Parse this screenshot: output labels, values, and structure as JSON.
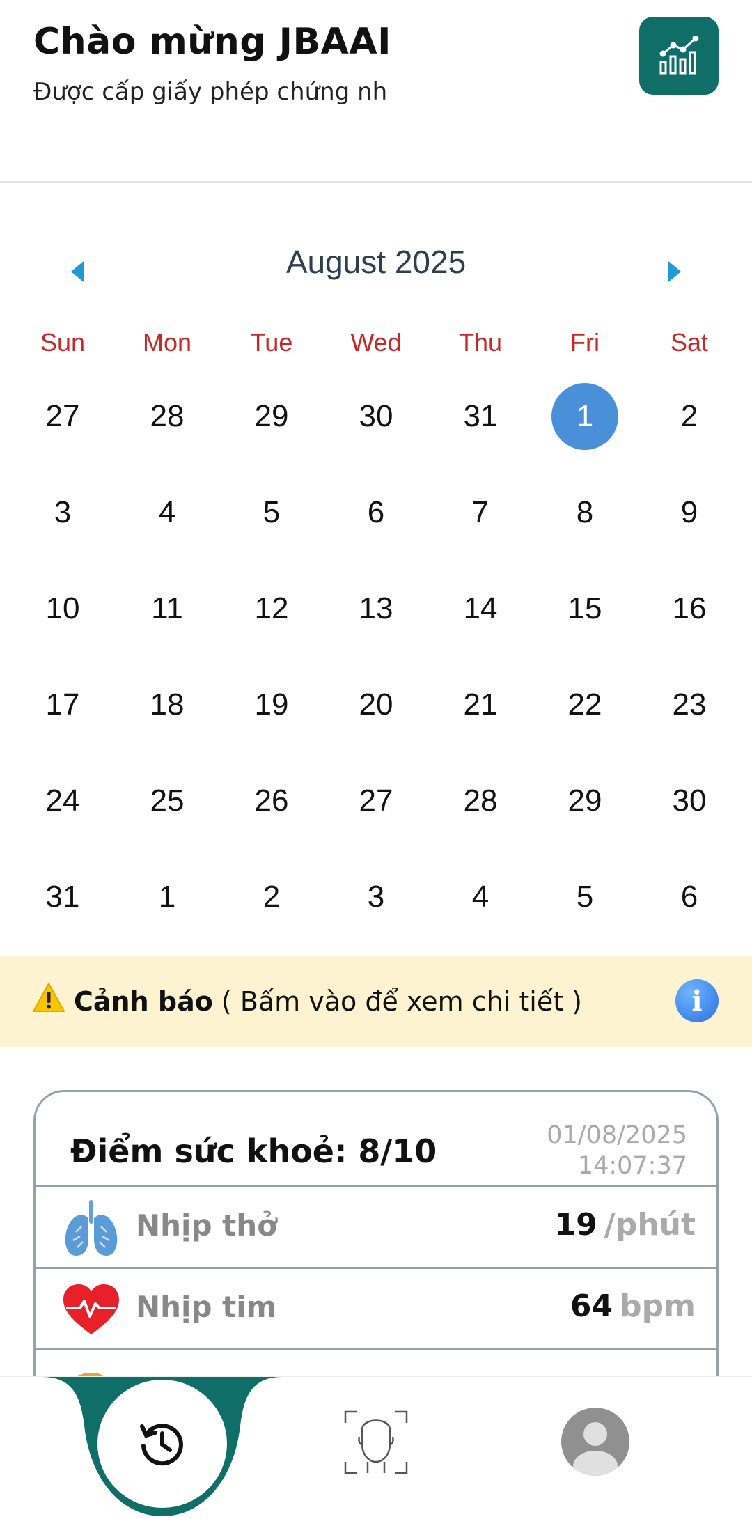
{
  "header": {
    "welcome": "Chào mừng JBAAI",
    "license": "Được cấp giấy phép chứng nh",
    "stats_icon": "chart-icon"
  },
  "calendar": {
    "month_title": "August 2025",
    "prev_icon": "caret-left-icon",
    "next_icon": "caret-right-icon",
    "weekdays": [
      "Sun",
      "Mon",
      "Tue",
      "Wed",
      "Thu",
      "Fri",
      "Sat"
    ],
    "days": [
      "27",
      "28",
      "29",
      "30",
      "31",
      "1",
      "2",
      "3",
      "4",
      "5",
      "6",
      "7",
      "8",
      "9",
      "10",
      "11",
      "12",
      "13",
      "14",
      "15",
      "16",
      "17",
      "18",
      "19",
      "20",
      "21",
      "22",
      "23",
      "24",
      "25",
      "26",
      "27",
      "28",
      "29",
      "30",
      "31",
      "1",
      "2",
      "3",
      "4",
      "5",
      "6"
    ],
    "selected_day": "1",
    "selected_color": "#4a90d9",
    "weekday_color": "#c62828"
  },
  "alert": {
    "title": "Cảnh báo",
    "detail": "( Bấm vào để xem chi tiết )",
    "icon": "warning-icon",
    "info_glyph": "i"
  },
  "health_card": {
    "score_label": "Điểm sức khoẻ: 8/10",
    "date": "01/08/2025",
    "time": "14:07:37",
    "rows": [
      {
        "label": "Nhịp thở",
        "value": "19",
        "unit": "/phút",
        "icon": "lungs-icon"
      },
      {
        "label": "Nhịp tim",
        "value": "64",
        "unit": "bpm",
        "icon": "heart-pulse-icon"
      }
    ]
  },
  "nav": {
    "accent": "#0f6e68",
    "items": [
      "history-icon",
      "face-scan-icon",
      "profile-icon"
    ]
  }
}
